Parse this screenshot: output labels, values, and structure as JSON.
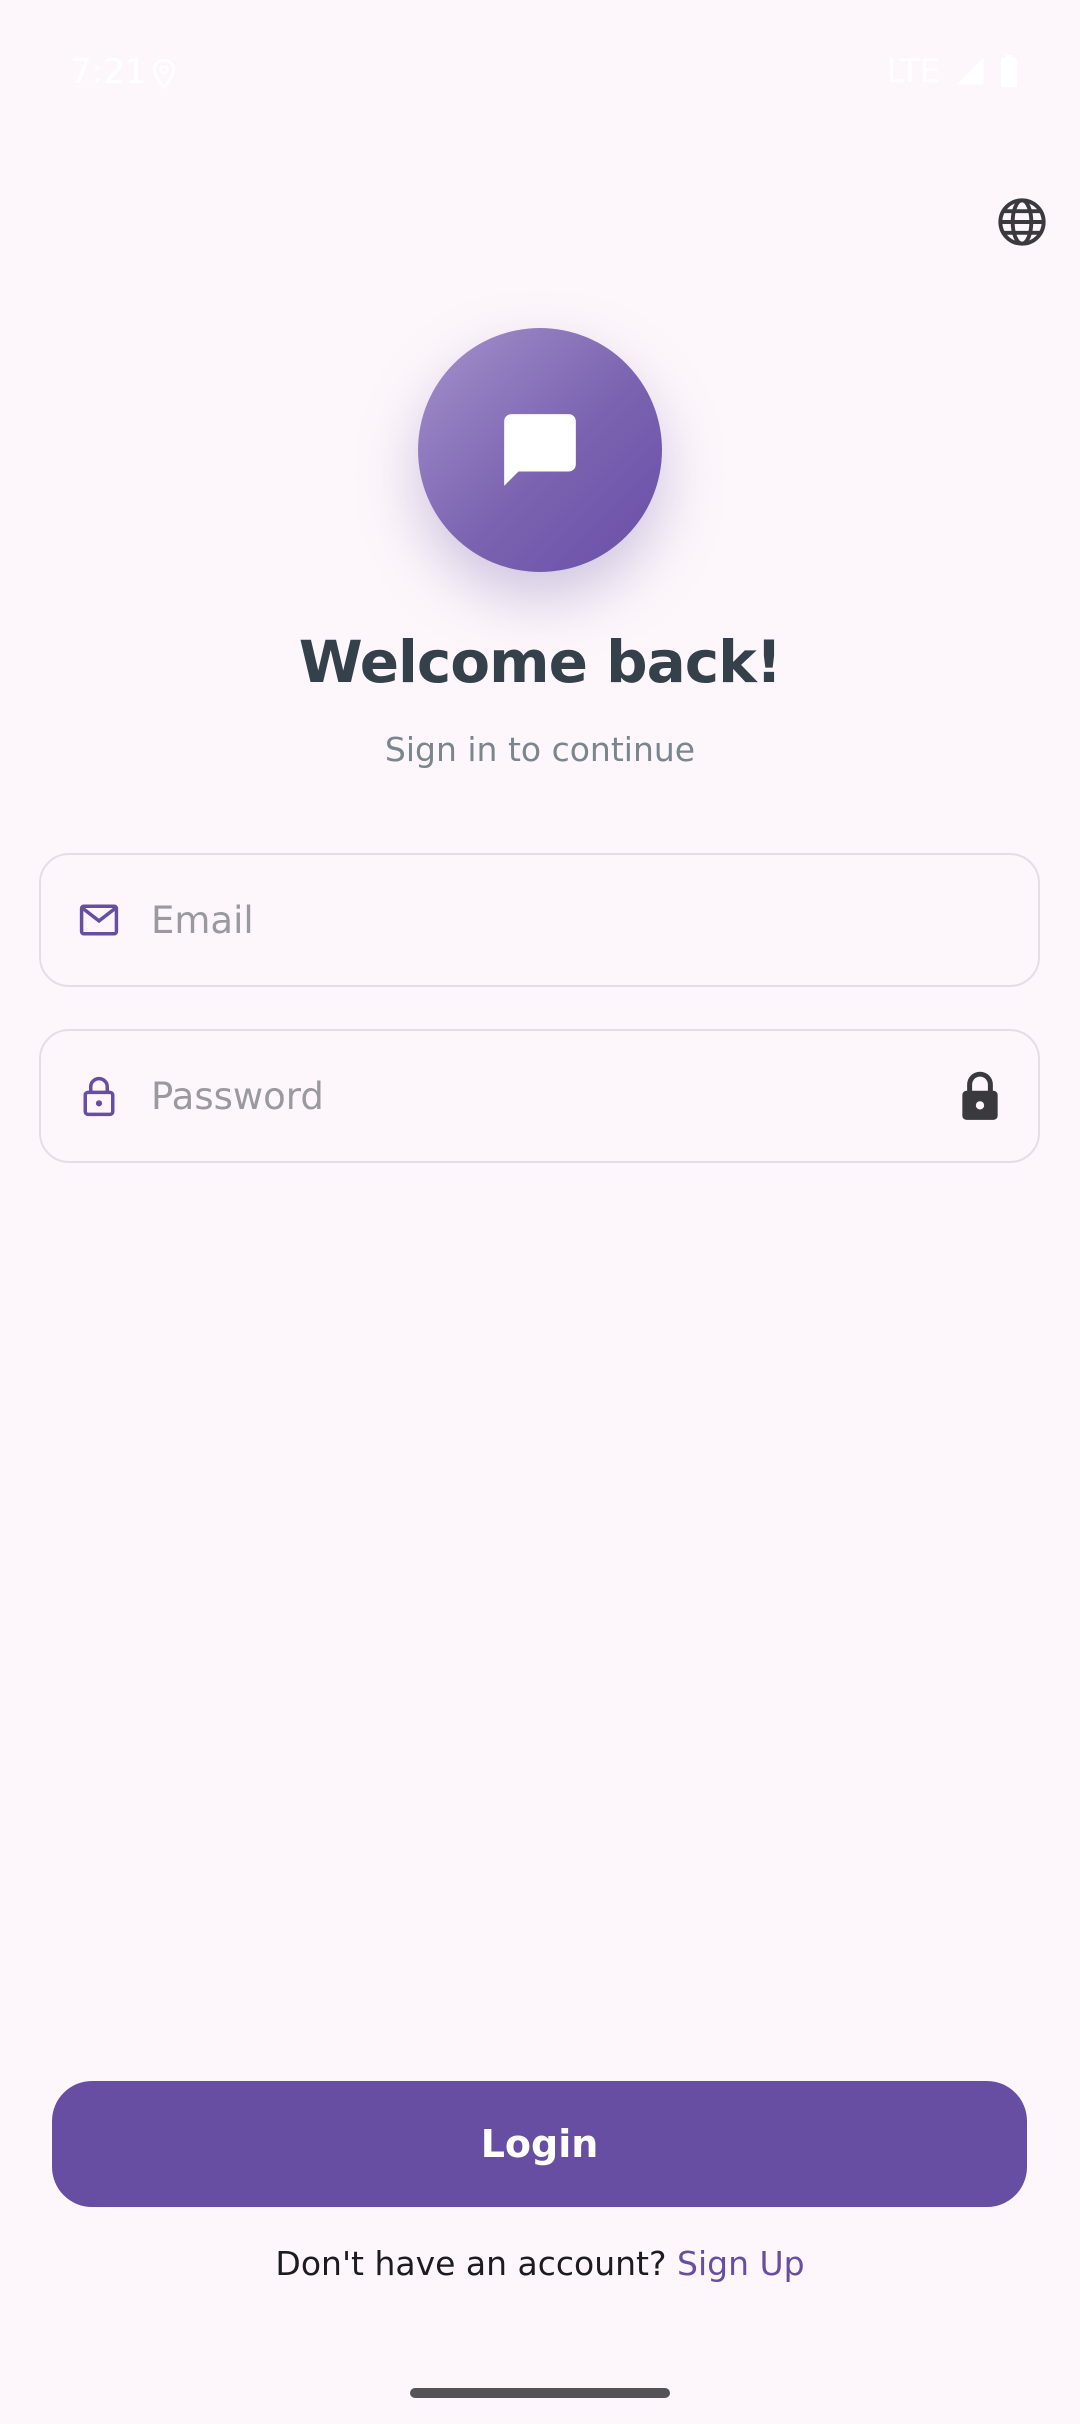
{
  "status_bar": {
    "time": "7:21",
    "network": "LTE",
    "icons": [
      "location-icon",
      "signal-icon",
      "battery-icon"
    ]
  },
  "header": {
    "language_icon": "globe-icon"
  },
  "logo": {
    "icon": "chat-bubble-icon"
  },
  "welcome": {
    "title": "Welcome back!",
    "subtitle": "Sign in to continue"
  },
  "form": {
    "email": {
      "icon": "mail-icon",
      "placeholder": "Email",
      "value": ""
    },
    "password": {
      "icon": "lock-outline-icon",
      "placeholder": "Password",
      "value": "",
      "toggle_icon": "lock-icon"
    },
    "login_label": "Login"
  },
  "signup": {
    "prompt": "Don't have an account?",
    "link_label": "Sign Up"
  },
  "colors": {
    "background": "#fdf7fb",
    "primary": "#674ea2",
    "title": "#35414a",
    "subtitle": "#7a868d",
    "field_border": "#e4dfe5"
  }
}
